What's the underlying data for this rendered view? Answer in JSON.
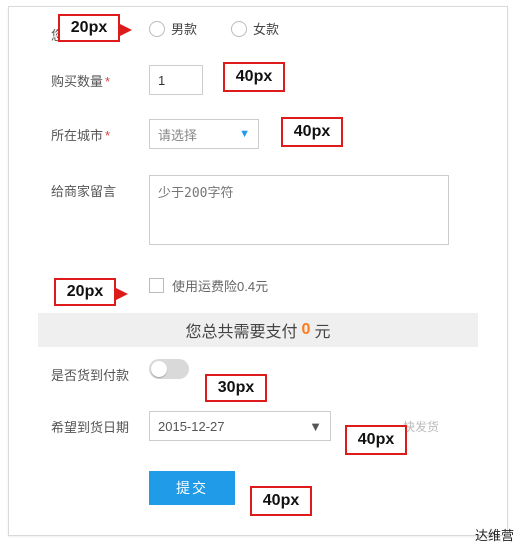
{
  "gender": {
    "label_cut": "您",
    "male": "男款",
    "female": "女款",
    "callout": "20px"
  },
  "qty": {
    "label": "购买数量",
    "value": "1",
    "callout": "40px"
  },
  "city": {
    "label": "所在城市",
    "placeholder": "请选择",
    "callout": "40px"
  },
  "message": {
    "label": "给商家留言",
    "placeholder": "少于200字符"
  },
  "insurance": {
    "label": "使用运费险0.4元",
    "callout": "20px"
  },
  "total": {
    "prefix": "您总共需要支付",
    "amount": "0",
    "suffix": "元"
  },
  "cod": {
    "label": "是否货到付款",
    "callout": "30px"
  },
  "date": {
    "label": "希望到货日期",
    "value": "2015-12-27",
    "hint": "快发货",
    "callout": "40px"
  },
  "submit": {
    "label": "提交",
    "callout": "40px"
  },
  "footer": "达维营"
}
